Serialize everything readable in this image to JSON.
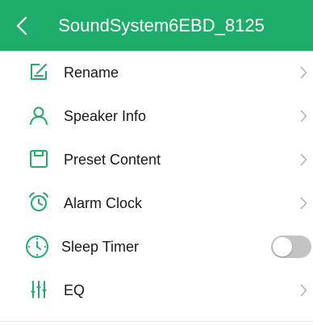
{
  "header": {
    "title": "SoundSystem6EBD_8125",
    "background": "#1ead6a"
  },
  "accent_color": "#1ead6a",
  "menu": {
    "items": [
      {
        "label": "Rename",
        "icon": "rename-icon",
        "control": "chevron"
      },
      {
        "label": "Speaker Info",
        "icon": "person-icon",
        "control": "chevron"
      },
      {
        "label": "Preset Content",
        "icon": "preset-icon",
        "control": "chevron"
      },
      {
        "label": "Alarm Clock",
        "icon": "alarm-clock-icon",
        "control": "chevron"
      },
      {
        "label": "Sleep Timer",
        "icon": "clock-icon",
        "control": "toggle",
        "toggle_on": false
      },
      {
        "label": "EQ",
        "icon": "equalizer-icon",
        "control": "chevron"
      }
    ]
  }
}
